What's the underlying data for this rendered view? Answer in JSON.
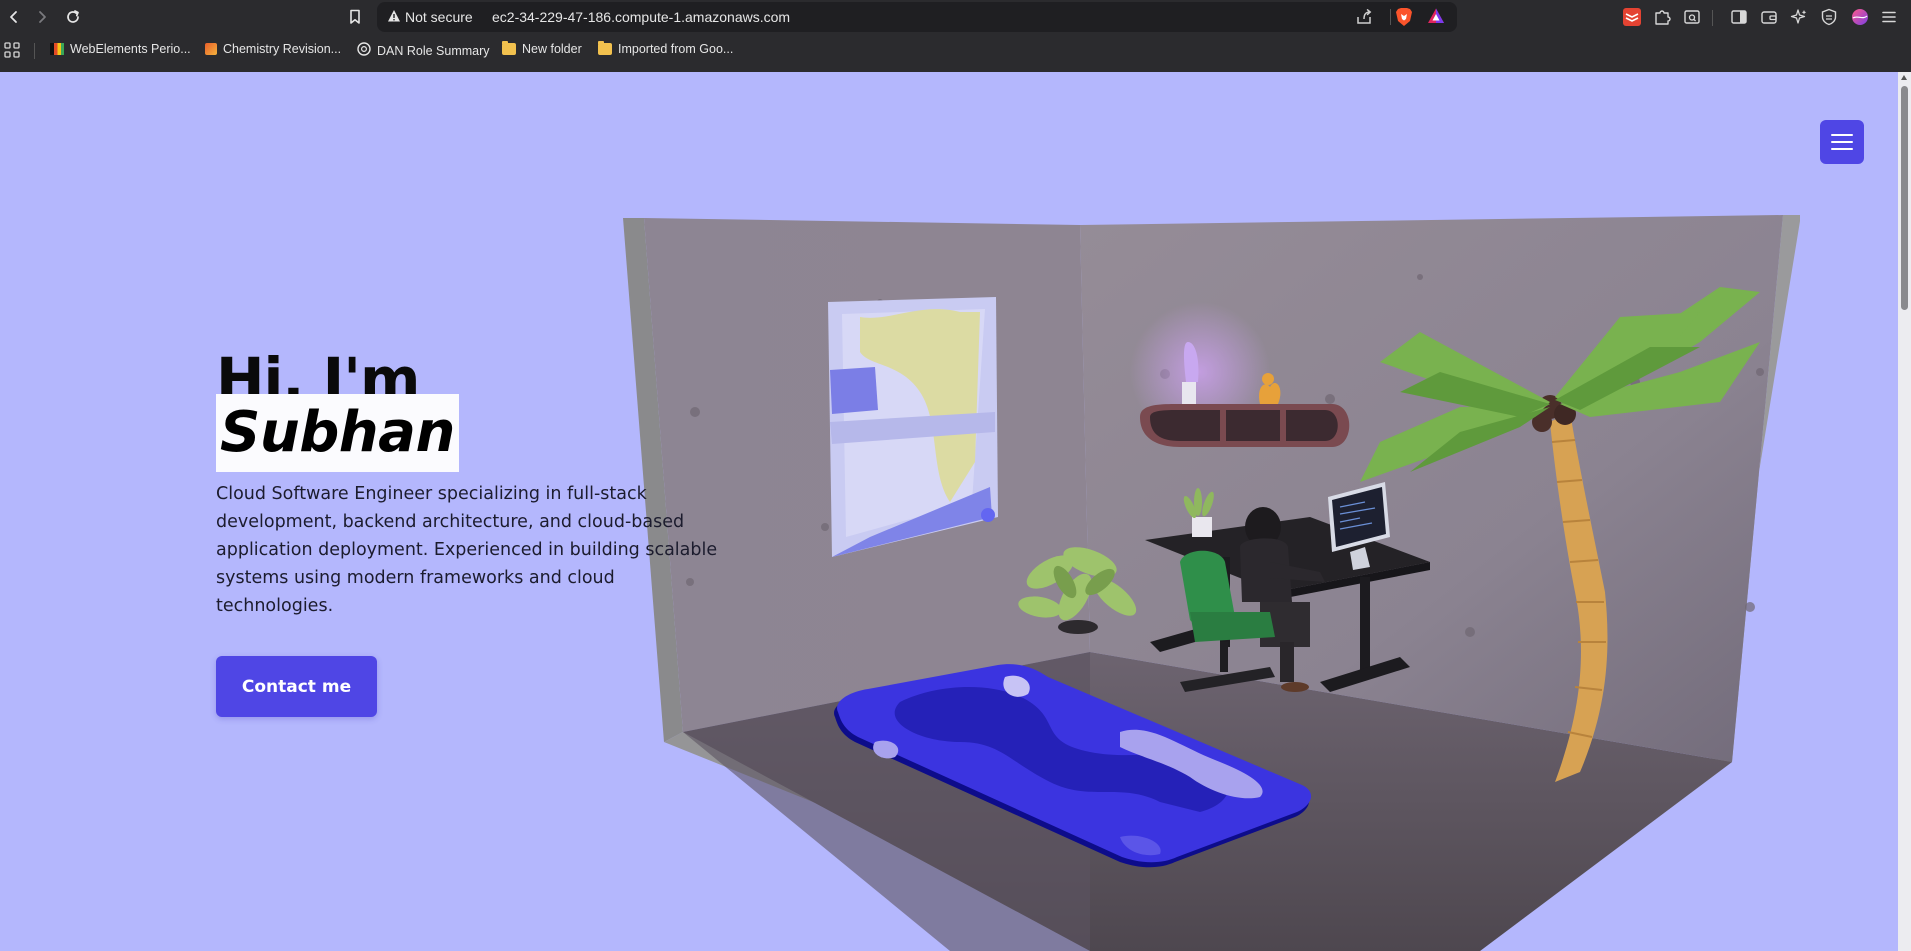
{
  "browser": {
    "security_label": "Not secure",
    "url": "ec2-34-229-47-186.compute-1.amazonaws.com",
    "bookmarks": [
      {
        "label": "WebElements Perio..."
      },
      {
        "label": "Chemistry Revision..."
      },
      {
        "label": "DAN Role Summary"
      },
      {
        "label": "New folder"
      },
      {
        "label": "Imported from Goo..."
      }
    ]
  },
  "hero": {
    "greeting": "Hi, I'm",
    "name": "Subhan",
    "description": "Cloud Software Engineer specializing in full-stack development, backend architecture, and cloud-based application deployment. Experienced in building scalable systems using modern frameworks and cloud technologies.",
    "contact_label": "Contact me"
  },
  "colors": {
    "page_background": "#b4b7fd",
    "accent": "#4f46e5"
  },
  "icons": [
    "back-icon",
    "forward-icon",
    "reload-icon",
    "bookmark-icon",
    "warning-icon",
    "share-icon",
    "brave-shield-icon",
    "brave-rewards-icon",
    "apps-icon",
    "hamburger-menu-icon"
  ]
}
